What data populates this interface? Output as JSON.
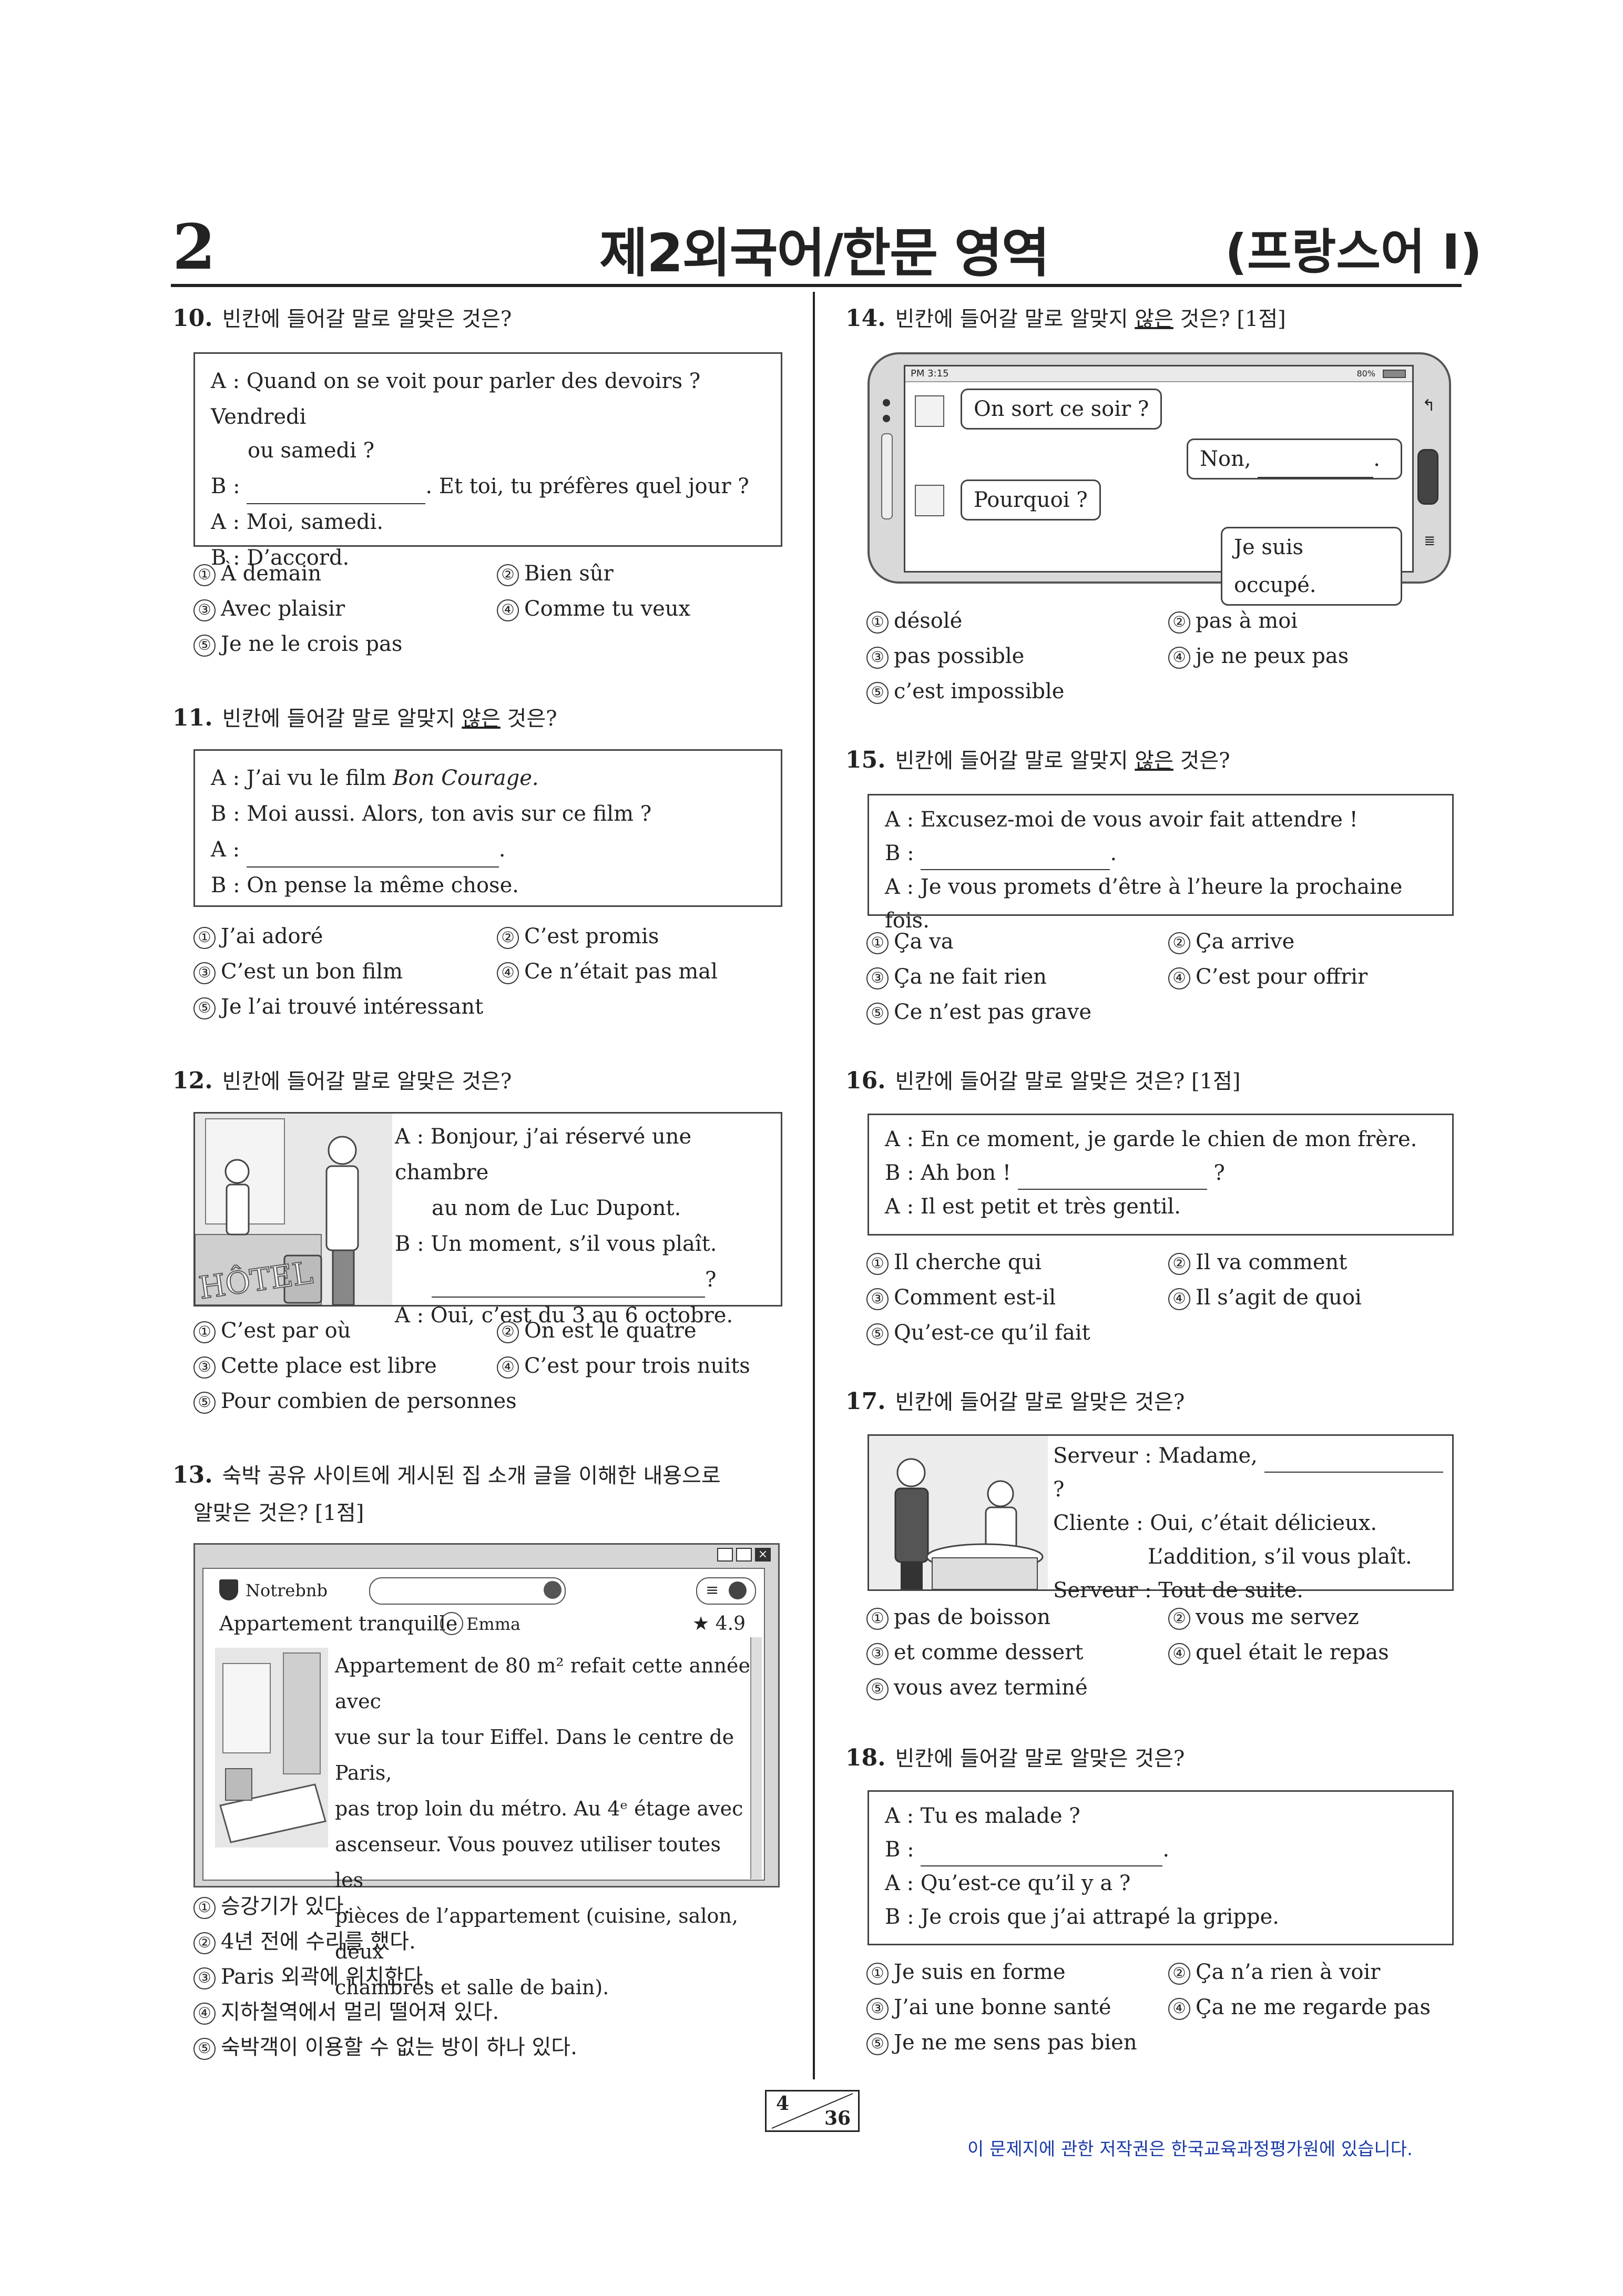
{
  "header": {
    "page_num": "2",
    "title": "제2외국어/한문 영역",
    "subject": "(프랑스어 I)"
  },
  "q10": {
    "num": "10.",
    "prompt": "빈칸에 들어갈 말로 알맞은 것은?",
    "lines": [
      "A : Quand on se voit pour parler des devoirs ? Vendredi",
      "ou samedi ?",
      "B : ",
      "A : Moi, samedi.",
      "B : D’accord."
    ],
    "line2_tail": ". Et toi, tu préfères quel jour ?",
    "options": [
      "À demain",
      "Bien sûr",
      "Avec plaisir",
      "Comme tu veux",
      "Je ne le crois pas"
    ]
  },
  "q11": {
    "num": "11.",
    "prompt_a": "빈칸에 들어갈 말로 알맞지 ",
    "prompt_u": "않은",
    "prompt_b": " 것은?",
    "lines": [
      "A : J’ai vu le film ",
      "B : Moi aussi. Alors, ton avis sur ce film ?",
      "A : ",
      "B : On pense la même chose."
    ],
    "film": "Bon Courage.",
    "options": [
      "J’ai adoré",
      "C’est promis",
      "C’est un bon film",
      "Ce n’était pas mal",
      "Je l’ai trouvé intéressant"
    ]
  },
  "q12": {
    "num": "12.",
    "prompt": "빈칸에 들어갈 말로 알맞은 것은?",
    "lines": [
      "A : Bonjour, j’ai réservé une chambre",
      "au nom de Luc Dupont.",
      "B : Un moment, s’il vous plaît.",
      "?",
      "A : Oui, c’est du 3 au 6 octobre."
    ],
    "hotel_sign": "HÔTEL",
    "options": [
      "C’est par où",
      "On est le quatre",
      "Cette place est libre",
      "C’est pour trois nuits",
      "Pour combien de personnes"
    ]
  },
  "q13": {
    "num": "13.",
    "prompt_l1": "숙박 공유 사이트에 게시된 집 소개 글을 이해한 내용으로",
    "prompt_l2": "알맞은 것은? [1점]",
    "site": "Notrebnb",
    "listing": "Appartement tranquille",
    "host": "Emma",
    "rating": "★ 4.9",
    "body": [
      "Appartement de 80 m² refait cette année avec",
      "vue sur la tour Eiffel. Dans le centre de Paris,",
      "pas trop loin du métro. Au 4ᵉ étage avec",
      "ascenseur. Vous pouvez utiliser toutes les",
      "pièces de l’appartement (cuisine, salon, deux",
      "chambres et salle de bain)."
    ],
    "options": [
      "승강기가 있다.",
      "4년 전에 수리를 했다.",
      "Paris 외곽에 위치한다.",
      "지하철역에서 멀리 떨어져 있다.",
      "숙박객이 이용할 수 없는 방이 하나 있다."
    ]
  },
  "q14": {
    "num": "14.",
    "prompt_a": "빈칸에 들어갈 말로 알맞지 ",
    "prompt_u": "않은",
    "prompt_b": " 것은? [1점]",
    "status_time": "PM 3:15",
    "status_right": "80%",
    "chat": [
      "On sort ce soir ?",
      "Non, ",
      "Pourquoi ?",
      "Je suis occupé."
    ],
    "options": [
      "désolé",
      "pas à moi",
      "pas possible",
      "je ne peux pas",
      "c’est impossible"
    ]
  },
  "q15": {
    "num": "15.",
    "prompt_a": "빈칸에 들어갈 말로 알맞지 ",
    "prompt_u": "않은",
    "prompt_b": " 것은?",
    "lines": [
      "A : Excusez-moi de vous avoir fait attendre !",
      "B : ",
      "A : Je vous promets d’être à l’heure la prochaine fois."
    ],
    "options": [
      "Ça va",
      "Ça arrive",
      "Ça ne fait rien",
      "C’est pour offrir",
      "Ce n’est pas grave"
    ]
  },
  "q16": {
    "num": "16.",
    "prompt": "빈칸에 들어갈 말로 알맞은 것은? [1점]",
    "lines": [
      "A : En ce moment, je garde le chien de mon frère.",
      "B : Ah bon ! ",
      "A : Il est petit et très gentil."
    ],
    "options": [
      "Il cherche qui",
      "Il va comment",
      "Comment est-il",
      "Il s’agit de quoi",
      "Qu’est-ce qu’il fait"
    ]
  },
  "q17": {
    "num": "17.",
    "prompt": "빈칸에 들어갈 말로 알맞은 것은?",
    "lines": [
      "Serveur : Madame, ",
      "Cliente  : Oui, c’était délicieux.",
      "L’addition, s’il vous plaît.",
      "Serveur : Tout de suite."
    ],
    "options": [
      "pas de boisson",
      "vous me servez",
      "et comme dessert",
      "quel était le repas",
      "vous avez terminé"
    ]
  },
  "q18": {
    "num": "18.",
    "prompt": "빈칸에 들어갈 말로 알맞은 것은?",
    "lines": [
      "A : Tu es malade ?",
      "B : ",
      "A : Qu’est-ce qu’il y a ?",
      "B : Je crois que j’ai attrapé la grippe."
    ],
    "options": [
      "Je suis en forme",
      "Ça n’a rien à voir",
      "J’ai une bonne santé",
      "Ça ne me regarde pas",
      "Je ne me sens pas bien"
    ]
  },
  "footer": {
    "page": "4",
    "total": "36",
    "copyright": "이 문제지에 관한 저작권은 한국교육과정평가원에 있습니다."
  },
  "marks": [
    "①",
    "②",
    "③",
    "④",
    "⑤"
  ]
}
